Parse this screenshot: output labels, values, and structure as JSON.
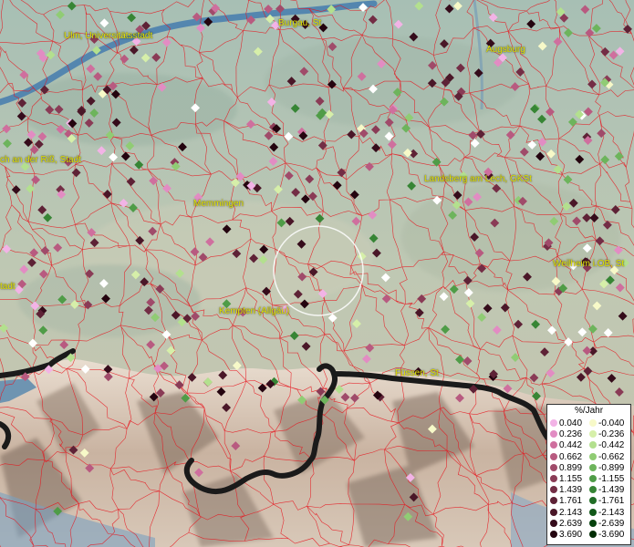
{
  "cities": [
    {
      "name": "Ulm, Universitätsstadt"
    },
    {
      "name": "Burgau, St"
    },
    {
      "name": "Augsburg"
    },
    {
      "name": "ch an der Riß, Stadt"
    },
    {
      "name": "Landsberg am Lech, GKSt"
    },
    {
      "name": "Memmingen"
    },
    {
      "name": "Weilheim i.OB, St"
    },
    {
      "name": "tadt"
    },
    {
      "name": "Kempten (Allgäu)"
    },
    {
      "name": "Füssen, St"
    }
  ],
  "legend": {
    "title": "%/Jahr",
    "positive": [
      {
        "value": "0.040",
        "color": "#f2b3e6"
      },
      {
        "value": "0.236",
        "color": "#e28cc3"
      },
      {
        "value": "0.442",
        "color": "#cf6f9e"
      },
      {
        "value": "0.662",
        "color": "#b85a80"
      },
      {
        "value": "0.899",
        "color": "#a04b6a"
      },
      {
        "value": "1.155",
        "color": "#8a3b56"
      },
      {
        "value": "1.439",
        "color": "#732d45"
      },
      {
        "value": "1.761",
        "color": "#5e2236"
      },
      {
        "value": "2.143",
        "color": "#4a1728"
      },
      {
        "value": "2.639",
        "color": "#350c1b"
      },
      {
        "value": "3.690",
        "color": "#24040f"
      }
    ],
    "negative": [
      {
        "value": "-0.040",
        "color": "#f7f9c8"
      },
      {
        "value": "-0.236",
        "color": "#d6efa9"
      },
      {
        "value": "-0.442",
        "color": "#b3e08e"
      },
      {
        "value": "-0.662",
        "color": "#90cc74"
      },
      {
        "value": "-0.899",
        "color": "#6db45c"
      },
      {
        "value": "-1.155",
        "color": "#4f9c47"
      },
      {
        "value": "-1.439",
        "color": "#378535"
      },
      {
        "value": "-1.761",
        "color": "#216d26"
      },
      {
        "value": "-2.143",
        "color": "#115718"
      },
      {
        "value": "-2.639",
        "color": "#06420d"
      },
      {
        "value": "-3.690",
        "color": "#002d05"
      }
    ]
  },
  "colors": {
    "boundary": "#e8121b",
    "river": "#4a7fae",
    "border": "#1a1a1a",
    "label": "#e6e600",
    "highlight": "#ffffff"
  }
}
